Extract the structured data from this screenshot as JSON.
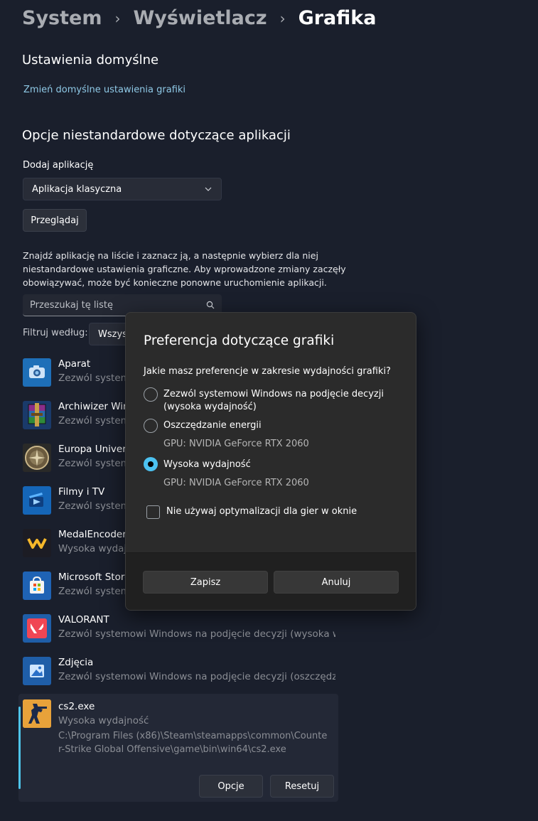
{
  "breadcrumb": {
    "items": [
      "System",
      "Wyświetlacz",
      "Grafika"
    ]
  },
  "defaults": {
    "title": "Ustawienia domyślne",
    "link": "Zmień domyślne ustawienia grafiki"
  },
  "custom": {
    "title": "Opcje niestandardowe dotyczące aplikacji",
    "add_label": "Dodaj aplikację",
    "app_type": "Aplikacja klasyczna",
    "browse": "Przeglądaj",
    "description": "Znajdź aplikację na liście i zaznacz ją, a następnie wybierz dla niej niestandardowe ustawienia graficzne. Aby wprowadzone zmiany zaczęły obowiązywać, może być konieczne ponowne uruchomienie aplikacji.",
    "search_placeholder": "Przeszukaj tę listę",
    "filter_label": "Filtruj według:",
    "filter_value": "Wszyst"
  },
  "apps": [
    {
      "name": "Aparat",
      "status": "Zezwól systemo",
      "icon": "camera-icon",
      "color": "#1e6fb8"
    },
    {
      "name": "Archiwizer Winl",
      "status": "Zezwól systemo",
      "icon": "winrar-icon",
      "color": "#7a3a8a"
    },
    {
      "name": "Europa Univers",
      "status": "Zezwól systemo",
      "icon": "europa-universalis-icon",
      "color": "#5a4a32"
    },
    {
      "name": "Filmy i TV",
      "status": "Zezwól systemo",
      "icon": "movies-tv-icon",
      "color": "#1a4a8a"
    },
    {
      "name": "MedalEncoder",
      "status": "Wysoka wydajn",
      "icon": "medal-icon",
      "color": "#1c1c24"
    },
    {
      "name": "Microsoft Store",
      "status": "Zezwól systemo",
      "icon": "store-icon",
      "color": "#2766b3"
    },
    {
      "name": "VALORANT",
      "status": "Zezwól systemowi Windows na podjęcie decyzji (wysoka wy...",
      "icon": "valorant-icon",
      "color": "#f04654"
    },
    {
      "name": "Zdjęcia",
      "status": "Zezwól systemowi Windows na podjęcie decyzji (oszczędza...",
      "icon": "photos-icon",
      "color": "#2a5fa8"
    }
  ],
  "selected_app": {
    "name": "cs2.exe",
    "status": "Wysoka wydajność",
    "path": "C:\\Program Files (x86)\\Steam\\steamapps\\common\\Counter-Strike Global Offensive\\game\\bin\\win64\\cs2.exe",
    "options": "Opcje",
    "reset": "Resetuj"
  },
  "dialog": {
    "title": "Preferencja dotyczące grafiki",
    "question": "Jakie masz preferencje w zakresie wydajności grafiki?",
    "options": [
      {
        "label": "Zezwól systemowi Windows na podjęcie decyzji (wysoka wydajność)",
        "gpu": "",
        "selected": false
      },
      {
        "label": "Oszczędzanie energii",
        "gpu": "GPU: NVIDIA GeForce RTX 2060",
        "selected": false
      },
      {
        "label": "Wysoka wydajność",
        "gpu": "GPU: NVIDIA GeForce RTX 2060",
        "selected": true
      }
    ],
    "checkbox": "Nie używaj optymalizacji dla gier w oknie",
    "save": "Zapisz",
    "cancel": "Anuluj"
  },
  "colors": {
    "accent": "#4cc2f1",
    "background": "#1a1f2c",
    "dialog": "#2b2b2b",
    "link": "#8fc9e6"
  }
}
